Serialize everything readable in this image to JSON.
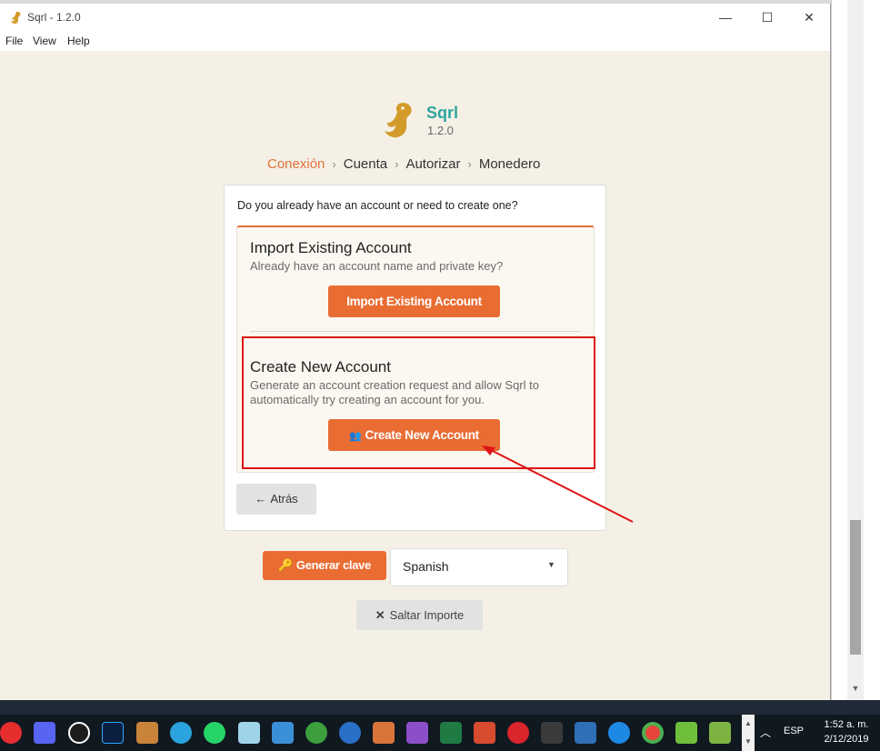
{
  "window": {
    "title": "Sqrl - 1.2.0",
    "minimize": "—",
    "maximize": "☐",
    "close": "✕"
  },
  "menu": [
    "File",
    "View",
    "Help"
  ],
  "logo": {
    "name": "Sqrl",
    "version": "1.2.0"
  },
  "breadcrumb": [
    "Conexión",
    "Cuenta",
    "Autorizar",
    "Monedero"
  ],
  "card": {
    "question": "Do you already have an account or need to create one?",
    "import": {
      "title": "Import Existing Account",
      "desc": "Already have an account name and private key?",
      "button": "Import Existing Account"
    },
    "create": {
      "title": "Create New Account",
      "desc_line1": "Generate an account creation request and allow Sqrl to",
      "desc_line2": "automatically try creating an account for you.",
      "button": "Create New Account"
    },
    "back_button": "Atrás"
  },
  "footer": {
    "generate_key": "Generar clave",
    "language": "Spanish",
    "skip_import": "Saltar Importe"
  },
  "taskbar": {
    "icons": [
      "record-icon",
      "discord-icon",
      "inkscape-icon",
      "photoshop-icon",
      "photos-icon",
      "telegram-icon",
      "whatsapp-icon",
      "notes-icon",
      "folder-icon",
      "earth-icon",
      "teamviewer-icon",
      "taskmgr-icon",
      "feather-icon",
      "excel-icon",
      "kiwi-icon",
      "mega-icon",
      "calculator-icon",
      "grid-app-icon",
      "messenger-icon",
      "chrome-icon",
      "frog-icon",
      "stack-icon"
    ],
    "lang": "ESP",
    "time": "1:52 a. m.",
    "date": "2/12/2019"
  },
  "colors": {
    "accent": "#e96c33",
    "brand": "#2fa5a0",
    "highlight": "#dd1515"
  }
}
